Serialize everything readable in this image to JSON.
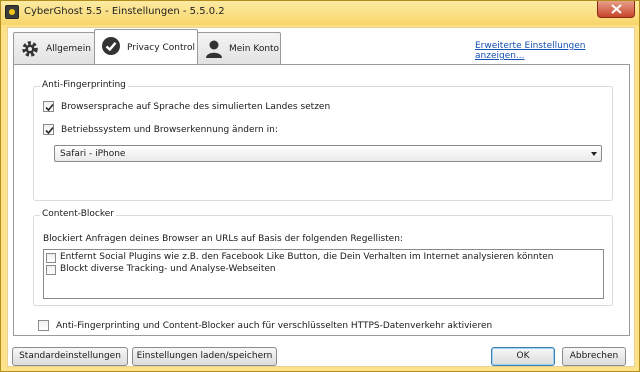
{
  "window": {
    "title": "CyberGhost 5.5 - Einstellungen - 5.5.0.2"
  },
  "tabs": [
    {
      "label": "Allgemein",
      "icon": "gear-icon",
      "active": false
    },
    {
      "label": "Privacy Control",
      "icon": "checkmark-circle-icon",
      "active": true
    },
    {
      "label": "Mein Konto",
      "icon": "user-icon",
      "active": false
    }
  ],
  "advanced_link": "Erweiterte Einstellungen anzeigen...",
  "anti_fingerprinting": {
    "title": "Anti-Fingerprinting",
    "option1": {
      "label": "Browsersprache auf Sprache des simulierten Landes setzen",
      "checked": true
    },
    "option2": {
      "label": "Betriebssystem und Browserkennung ändern in:",
      "checked": true
    },
    "browser_select": {
      "value": "Safari - iPhone"
    }
  },
  "content_blocker": {
    "title": "Content-Blocker",
    "description": "Blockiert Anfragen deines Browser an URLs auf Basis der folgenden Regellisten:",
    "items": [
      {
        "label": "Entfernt Social Plugins wie z.B. den Facebook Like Button, die Dein Verhalten im Internet analysieren könnten",
        "checked": false
      },
      {
        "label": "Blockt diverse Tracking- und Analyse-Webseiten",
        "checked": false
      }
    ]
  },
  "https_option": {
    "label": "Anti-Fingerprinting und Content-Blocker auch für verschlüsselten HTTPS-Datenverkehr aktivieren",
    "checked": false
  },
  "buttons": {
    "defaults": "Standardeinstellungen",
    "load_save": "Einstellungen laden/speichern",
    "ok": "OK",
    "cancel": "Abbrechen"
  },
  "colors": {
    "frame": "#fde28a",
    "link": "#1650b0",
    "close_button": "#c6452b"
  }
}
